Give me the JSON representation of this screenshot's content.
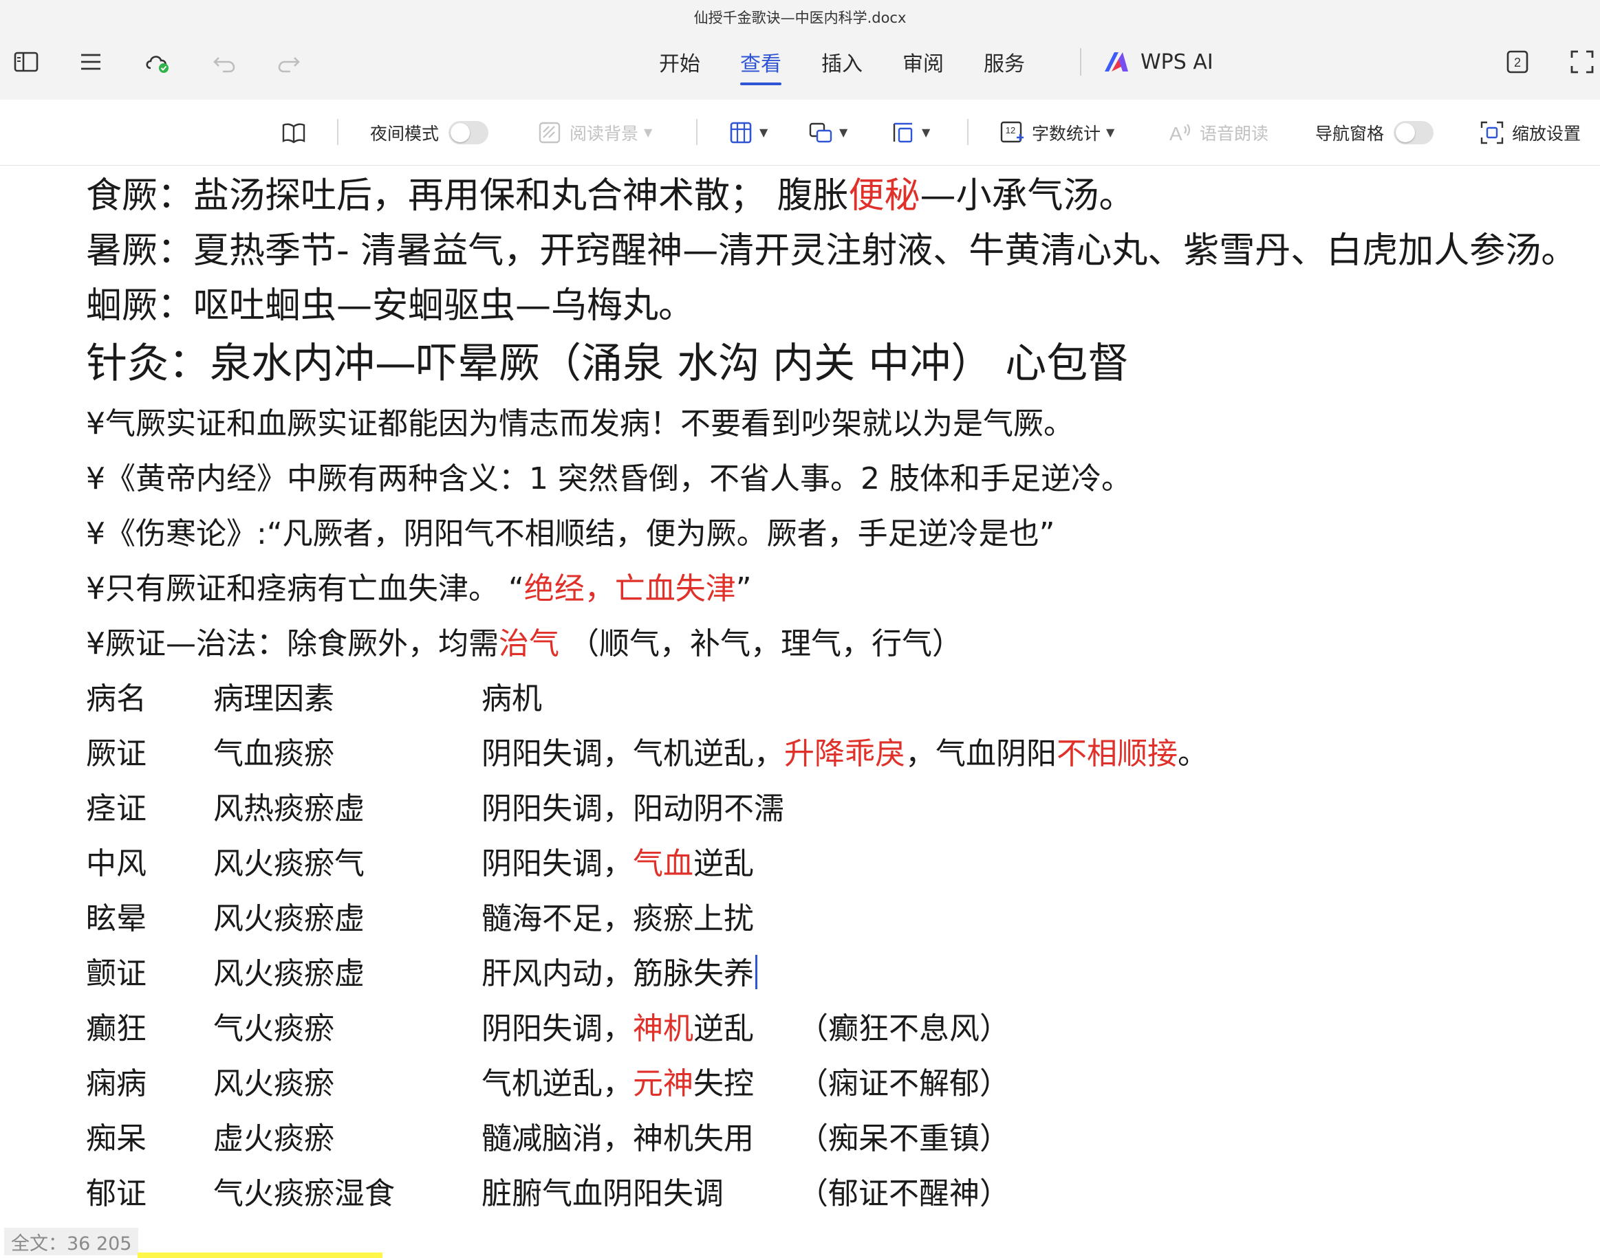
{
  "window": {
    "title": "仙授千金歌诀—中医内科学.docx"
  },
  "toolbar": {
    "icons": [
      "sidebar-icon",
      "menu-icon",
      "cloud-sync-icon",
      "undo-icon",
      "redo-icon"
    ],
    "menu_tabs": [
      {
        "label": "开始",
        "active": false
      },
      {
        "label": "查看",
        "active": true
      },
      {
        "label": "插入",
        "active": false
      },
      {
        "label": "审阅",
        "active": false
      },
      {
        "label": "服务",
        "active": false
      }
    ],
    "wps_ai": "WPS AI",
    "page_badge": "2"
  },
  "ribbon": {
    "night_mode": "夜间模式",
    "read_background": "阅读背景",
    "word_count": "字数统计",
    "word_count_icon": "12",
    "read_aloud": "语音朗读",
    "nav_pane": "导航窗格",
    "zoom_settings": "缩放设置"
  },
  "document": {
    "p1_a": "食厥：盐汤探吐后，再用保和丸合神术散；  腹胀",
    "p1_red": "便秘",
    "p1_b": "—小承气汤。",
    "p2": "暑厥：夏热季节- 清暑益气，开窍醒神—清开灵注射液、牛黄清心丸、紫雪丹、白虎加人参汤。",
    "p3": "蛔厥：呕吐蛔虫—安蛔驱虫—乌梅丸。",
    "p4": "针灸：泉水内冲—吓晕厥（涌泉 水沟 内关 中冲） 心包督",
    "p5": "¥气厥实证和血厥实证都能因为情志而发病！不要看到吵架就以为是气厥。",
    "p6": "¥《黄帝内经》中厥有两种含义：1 突然昏倒，不省人事。2 肢体和手足逆冷。",
    "p7": "¥《伤寒论》:“凡厥者，阴阳气不相顺结，便为厥。厥者，手足逆冷是也”",
    "p8_a": "¥只有厥证和痉病有亡血失津。 “",
    "p8_red": "绝经，亡血失津",
    "p8_b": "”",
    "p9_a": "¥厥证—治法：除食厥外，均需",
    "p9_red": "治气",
    "p9_b": "  （顺气，补气，理气，行气）"
  },
  "table": {
    "headers": [
      "病名",
      "病理因素",
      "病机"
    ],
    "rows": [
      {
        "name": "厥证",
        "factor": "气血痰瘀",
        "m_a": "阴阳失调，气机逆乱，",
        "m_red": "升降乖戾",
        "m_b": "，气血阴阳",
        "m_red2": "不相顺接",
        "m_c": "。",
        "note": ""
      },
      {
        "name": "痉证",
        "factor": "风热痰瘀虚",
        "m_a": "阴阳失调，阳动阴不濡",
        "m_red": "",
        "m_b": "",
        "m_red2": "",
        "m_c": "",
        "note": ""
      },
      {
        "name": "中风",
        "factor": "风火痰瘀气",
        "m_a": "阴阳失调，",
        "m_red": "气血",
        "m_b": "逆乱",
        "m_red2": "",
        "m_c": "",
        "note": ""
      },
      {
        "name": "眩晕",
        "factor": "风火痰瘀虚",
        "m_a": "髓海不足，痰瘀上扰",
        "m_red": "",
        "m_b": "",
        "m_red2": "",
        "m_c": "",
        "note": ""
      },
      {
        "name": "颤证",
        "factor": "风火痰瘀虚",
        "m_a": "肝风内动，筋脉失养",
        "m_red": "",
        "m_b": "",
        "m_red2": "",
        "m_c": "",
        "note": ""
      },
      {
        "name": "癫狂",
        "factor": "气火痰瘀",
        "m_a": "阴阳失调，",
        "m_red": "神机",
        "m_b": "逆乱",
        "m_red2": "",
        "m_c": "",
        "note": "（癫狂不息风）"
      },
      {
        "name": "痫病",
        "factor": "风火痰瘀",
        "m_a": "气机逆乱，",
        "m_red": "元神",
        "m_b": "失控",
        "m_red2": "",
        "m_c": "",
        "note": "（痫证不解郁）"
      },
      {
        "name": "痴呆",
        "factor": "虚火痰瘀",
        "m_a": "髓减脑消，神机失用",
        "m_red": "",
        "m_b": "",
        "m_red2": "",
        "m_c": "",
        "note": "（痴呆不重镇）"
      },
      {
        "name": "郁证",
        "factor": "气火痰瘀湿食",
        "m_a": "脏腑气血阴阳失调",
        "m_red": "",
        "m_b": "",
        "m_red2": "",
        "m_c": "",
        "note": "（郁证不醒神）"
      }
    ]
  },
  "status": {
    "word_count": "全文：36 205"
  },
  "colors": {
    "accent": "#2f55d4",
    "highlight_red": "#e0302a",
    "status_highlight": "#fff64a"
  }
}
